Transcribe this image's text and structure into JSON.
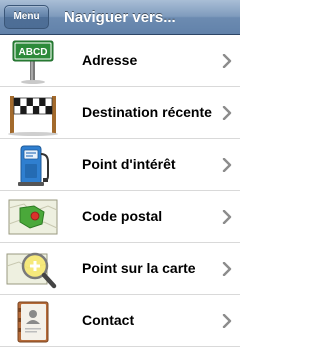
{
  "header": {
    "menu_label": "Menu",
    "title": "Naviguer vers..."
  },
  "rows": [
    {
      "label": "Adresse",
      "icon": "address-sign-icon"
    },
    {
      "label": "Destination récente",
      "icon": "checkered-flag-icon"
    },
    {
      "label": "Point d'intérêt",
      "icon": "fuel-pump-icon"
    },
    {
      "label": "Code postal",
      "icon": "postal-code-map-icon"
    },
    {
      "label": "Point sur la carte",
      "icon": "map-magnifier-icon"
    },
    {
      "label": "Contact",
      "icon": "address-book-icon"
    }
  ],
  "icon_text": {
    "address_sign": "ABCD"
  },
  "colors": {
    "nav_bar": "#6c8bb1",
    "menu_button": "#4e6f97",
    "row_separator": "#d9d9d9",
    "chevron": "#8c8c8c"
  }
}
